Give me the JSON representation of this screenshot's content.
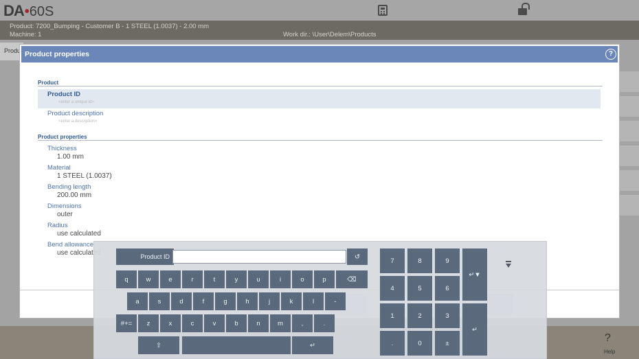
{
  "app": {
    "logo_main": "DA",
    "logo_dot": "•",
    "logo_version": "60S"
  },
  "header": {
    "calculator_icon": "calculator-icon",
    "lock_icon": "unlock-icon"
  },
  "infobar": {
    "product": "Product: 7200_Bumping - Customer B - 1 STEEL (1.0037) - 2.00 mm",
    "machine": "Machine: 1",
    "work_dir": "Work dir.: \\User\\Delem\\Products"
  },
  "background": {
    "tab_label": "Produ",
    "help_icon": "?",
    "help_label": "Help"
  },
  "dialog": {
    "title": "Product properties",
    "help_icon": "?",
    "sections": {
      "product": "Product",
      "properties": "Product properties"
    },
    "fields": {
      "product_id": {
        "label": "Product ID",
        "placeholder": "<enter a unique id>"
      },
      "product_description": {
        "label": "Product description",
        "placeholder": "<enter a description>"
      },
      "thickness": {
        "label": "Thickness",
        "value": "1.00 mm"
      },
      "material": {
        "label": "Material",
        "value": "1 STEEL (1.0037)"
      },
      "bending_length": {
        "label": "Bending length",
        "value": "200.00 mm"
      },
      "dimensions": {
        "label": "Dimensions",
        "value": "outer"
      },
      "radius": {
        "label": "Radius",
        "value": "use calculated"
      },
      "bend_allowance": {
        "label": "Bend allowance",
        "value": "use calculated"
      }
    }
  },
  "keyboard": {
    "input_label": "Product ID",
    "input_value": "",
    "undo": "↺",
    "row1": [
      "q",
      "w",
      "e",
      "r",
      "t",
      "y",
      "u",
      "i",
      "o",
      "p"
    ],
    "backspace": "⌫",
    "row2": [
      "a",
      "s",
      "d",
      "f",
      "g",
      "h",
      "j",
      "k",
      "l",
      "-"
    ],
    "symbols": "#+=",
    "row3": [
      "z",
      "x",
      "c",
      "v",
      "b",
      "n",
      "m",
      ",",
      "."
    ],
    "shift": "⇧",
    "space": "",
    "enter": "↵",
    "numpad": {
      "row1": [
        "7",
        "8",
        "9"
      ],
      "row2": [
        "4",
        "5",
        "6"
      ],
      "row3": [
        "1",
        "2",
        "3"
      ],
      "row4": [
        ".",
        "0",
        "±"
      ],
      "tab": "↵▼",
      "enter": "↵"
    }
  }
}
